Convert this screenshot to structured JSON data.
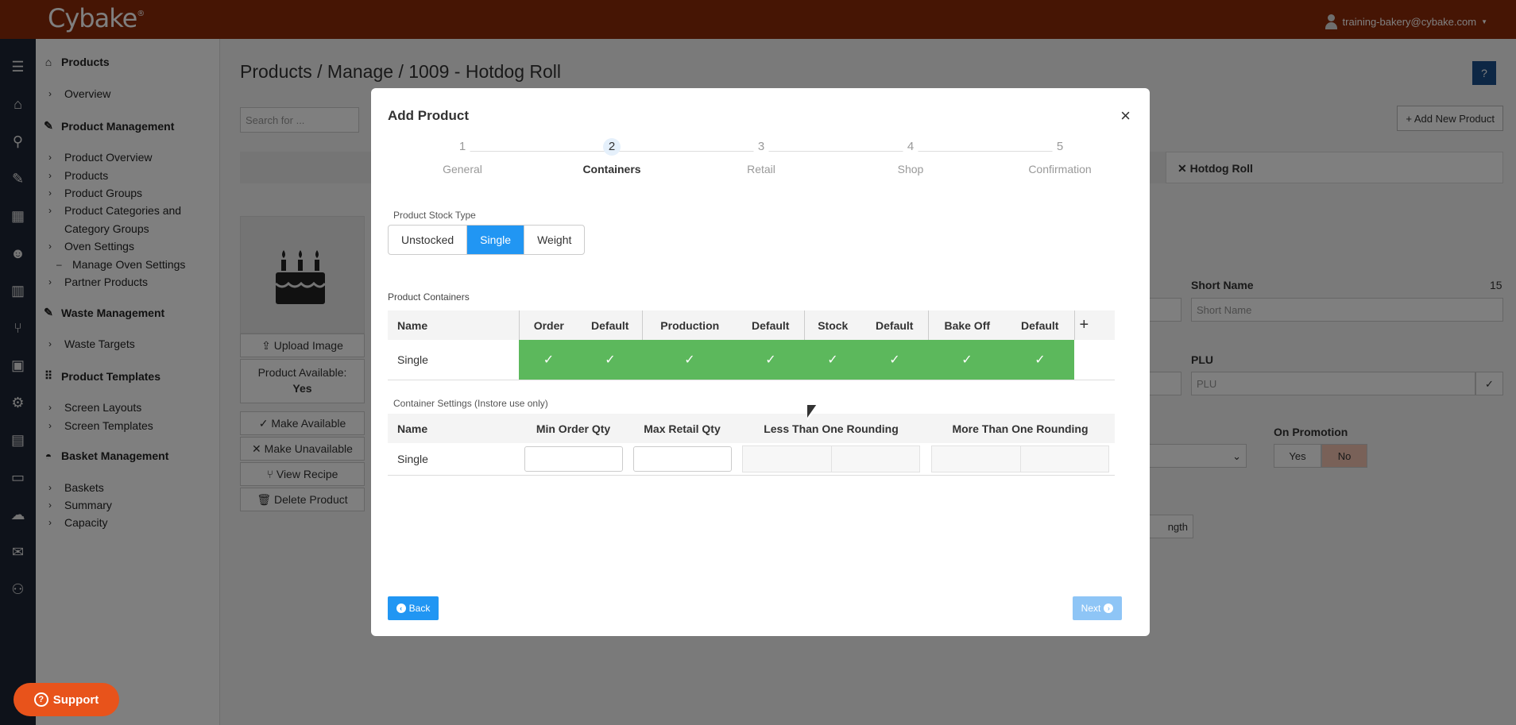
{
  "app": {
    "logo": "Cybake",
    "logo_mark": "®",
    "user_email": "training-bakery@cybake.com"
  },
  "iconrail": [
    "menu-icon",
    "home-icon",
    "search-icon",
    "edit-icon",
    "store-icon",
    "users-icon",
    "factory-icon",
    "utensils-icon",
    "bakery-icon",
    "cogs-icon",
    "print-icon",
    "money-icon",
    "cloud-icon",
    "mail-icon",
    "user-cog-icon"
  ],
  "sidebar": {
    "products": "Products",
    "overview": "Overview",
    "product_management": "Product Management",
    "pm_items": [
      "Product Overview",
      "Products",
      "Product Groups",
      "Product Categories and",
      "Category Groups",
      "Oven Settings"
    ],
    "manage_oven": "Manage Oven Settings",
    "partner_products": "Partner Products",
    "waste_management": "Waste Management",
    "waste_targets": "Waste Targets",
    "product_templates": "Product Templates",
    "screen_layouts": "Screen Layouts",
    "screen_templates": "Screen Templates",
    "basket_management": "Basket Management",
    "basket_items": [
      "Baskets",
      "Summary",
      "Capacity"
    ]
  },
  "page": {
    "title": "Products / Manage / 1009 - Hotdog Roll",
    "help": "?",
    "search_placeholder": "Search for ...",
    "add_new_product": "Add New Product",
    "open_tab": "Hotdog Roll",
    "upload_image": "Upload Image",
    "product_available_label": "Product Available:",
    "product_available_value": "Yes",
    "make_available": "Make Available",
    "make_unavailable": "Make Unavailable",
    "view_recipe": "View Recipe",
    "delete_product": "Delete Product",
    "short_name_label": "Short Name",
    "short_name_count": "15",
    "short_name_placeholder": "Short Name",
    "plu_label": "PLU",
    "plu_placeholder": "PLU",
    "on_promotion_label": "On Promotion",
    "promo_yes": "Yes",
    "promo_no": "No",
    "length_fragment": "ngth"
  },
  "support": "Support",
  "modal": {
    "title": "Add Product",
    "close": "×",
    "steps": [
      {
        "num": "1",
        "label": "General"
      },
      {
        "num": "2",
        "label": "Containers"
      },
      {
        "num": "3",
        "label": "Retail"
      },
      {
        "num": "4",
        "label": "Shop"
      },
      {
        "num": "5",
        "label": "Confirmation"
      }
    ],
    "active_step": 2,
    "stock_type_label": "Product Stock Type",
    "stock_types": [
      "Unstocked",
      "Single",
      "Weight"
    ],
    "stock_type_selected": "Single",
    "product_containers_label": "Product Containers",
    "pc_headers": [
      "Name",
      "Order",
      "Default",
      "Production",
      "Default",
      "Stock",
      "Default",
      "Bake Off",
      "Default",
      "+"
    ],
    "pc_row": {
      "name": "Single",
      "checks": [
        true,
        true,
        true,
        true,
        true,
        true,
        true,
        true
      ]
    },
    "container_settings_label": "Container Settings (Instore use only)",
    "cs_headers": [
      "Name",
      "Min Order Qty",
      "Max Retail Qty",
      "Less Than One Rounding",
      "More Than One Rounding"
    ],
    "cs_row": {
      "name": "Single",
      "min_order_qty": "",
      "max_retail_qty": ""
    },
    "back": "Back",
    "next": "Next"
  },
  "colors": {
    "topbar": "#8d2a08",
    "rail": "#1d2434",
    "accent": "#2196f3",
    "green": "#5cb85c",
    "support": "#e8531b"
  }
}
